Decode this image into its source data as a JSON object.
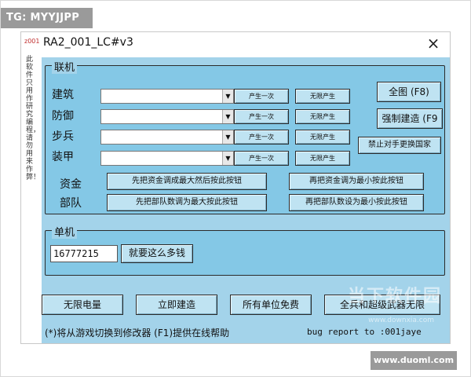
{
  "overlay": {
    "tg_label": "TG: MYYJJPP",
    "site_label": "www.duoml.com"
  },
  "window": {
    "title": "RA2_001_LC#v3",
    "icon_text": "z001",
    "close_glyph": "×",
    "side_note": "此软件只用作研究编程，请勿用来作弊！"
  },
  "online": {
    "group_title": "联机",
    "rows": [
      {
        "label": "建筑",
        "btn1": "产生一次",
        "btn2": "无限产生"
      },
      {
        "label": "防御",
        "btn1": "产生一次",
        "btn2": "无限产生"
      },
      {
        "label": "步兵",
        "btn1": "产生一次",
        "btn2": "无限产生"
      },
      {
        "label": "装甲",
        "btn1": "产生一次",
        "btn2": "无限产生"
      }
    ],
    "combo_arrow": "▼",
    "full_map_btn": "全图 (F8)",
    "force_build_btn": "强制建造 (F9",
    "ban_switch_btn": "禁止对手更换国家",
    "funds_label": "资金",
    "troops_label": "部队",
    "funds_max_btn": "先把资金调成最大然后按此按钮",
    "funds_min_btn": "再把资金调为最小按此按钮",
    "troops_max_btn": "先把部队数调为最大按此按钮",
    "troops_min_btn": "再把部队数设为最小按此按钮"
  },
  "single": {
    "group_title": "单机",
    "money_value": "16777215",
    "money_btn": "就要这么多钱"
  },
  "bottom_buttons": {
    "power": "无限电量",
    "instant_build": "立即建造",
    "free_units": "所有单位免费",
    "super_weapon": "全兵和超级武器无限"
  },
  "footer": {
    "hint": "(*)将从游戏切换到修改器  (F1)提供在线帮助",
    "bug_report": "bug report to :001jaye"
  },
  "watermark": {
    "main": "当下软件园",
    "sub": "www.downxia.com"
  }
}
